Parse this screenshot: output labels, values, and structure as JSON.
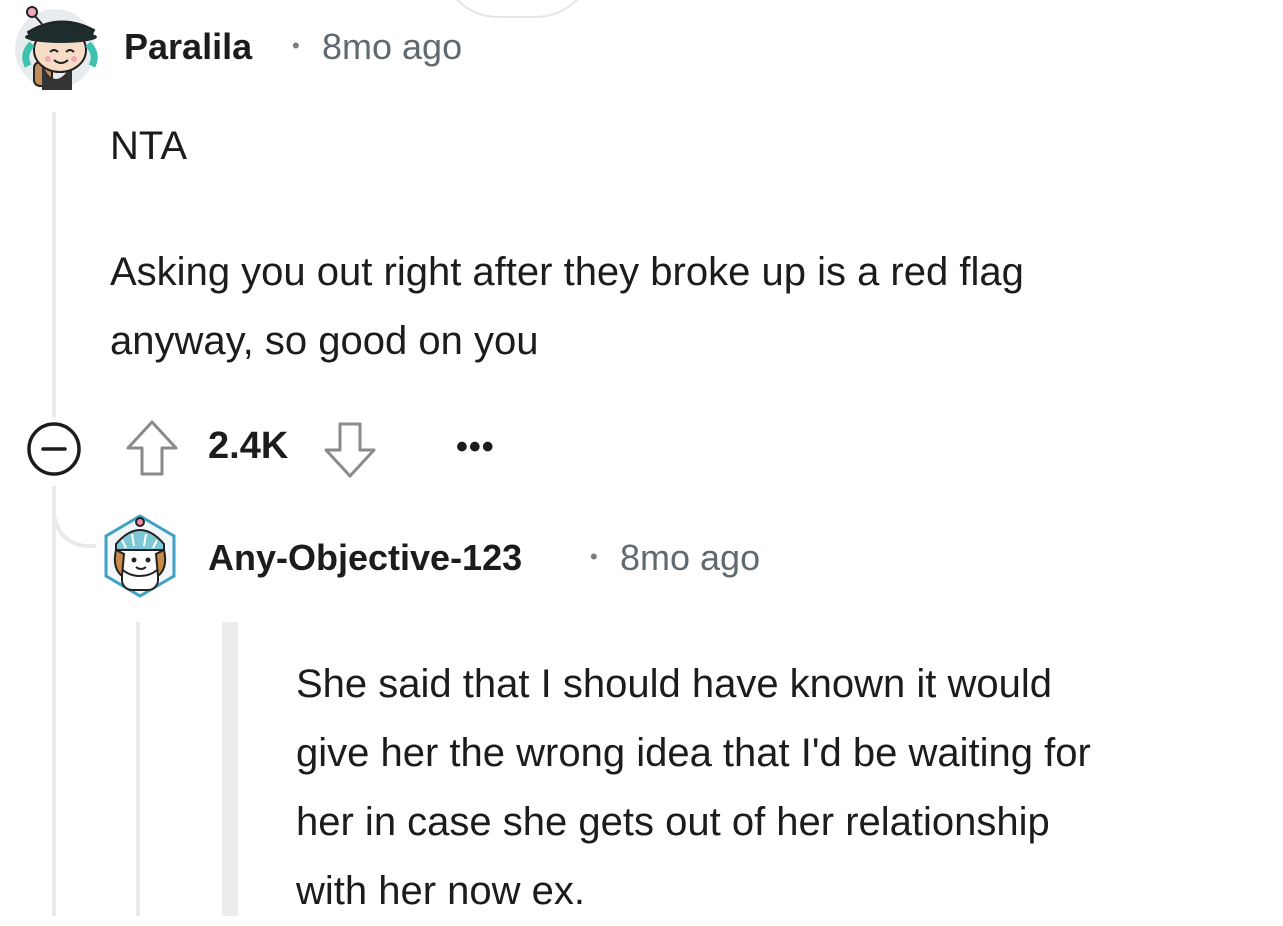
{
  "comments": [
    {
      "username": "Paralila",
      "separator": "•",
      "timestamp": "8mo ago",
      "body_lines": [
        "NTA",
        "Asking you out right after they broke up is a red flag",
        "anyway, so good on you"
      ],
      "votes": "2.4K",
      "more_label": "•••"
    },
    {
      "username": "Any-Objective-123",
      "separator": "•",
      "timestamp": "8mo ago",
      "body_lines": [
        "She said that I should have known it would",
        "give her the wrong idea that I'd be waiting for",
        "her in case she gets out of her relationship",
        "with her now ex."
      ]
    }
  ],
  "icons": {
    "collapse": "collapse-minus-icon",
    "upvote": "upvote-arrow-icon",
    "downvote": "downvote-arrow-icon",
    "more": "more-options-icon"
  },
  "colors": {
    "text": "#1c1c1c",
    "muted": "#5f6a70",
    "thread_line": "#e9e9e9"
  }
}
